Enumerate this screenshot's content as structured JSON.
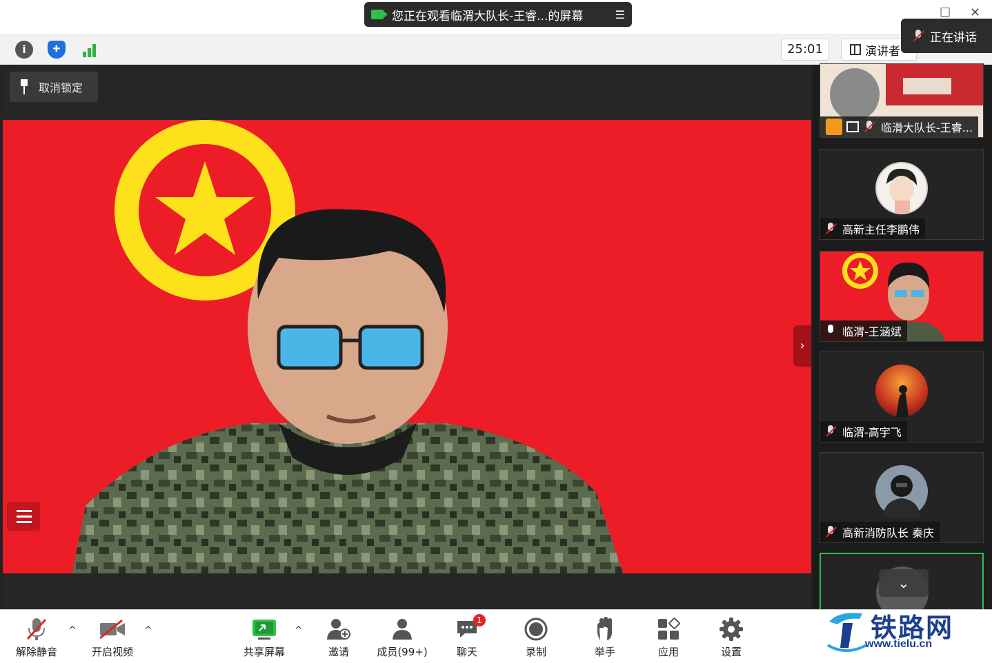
{
  "window": {
    "view_banner": "您正在观看临渭大队长-王睿...的屏幕",
    "view_menu_glyph": "☰"
  },
  "infobar": {
    "timer": "25:01",
    "view_mode_label": "演讲者",
    "speaking_label": "正在讲话"
  },
  "stage": {
    "unpin_label": "取消锁定",
    "side_toggle_glyph": "›"
  },
  "gallery": {
    "tiles": [
      {
        "name": "临滑大队长-王睿...",
        "mic": "off"
      },
      {
        "name": "高新主任李鹏伟",
        "mic": "off"
      },
      {
        "name": "临渭-王涵斌",
        "mic": "on"
      },
      {
        "name": "临渭-高宇飞",
        "mic": "off"
      },
      {
        "name": "高新消防队长 秦庆",
        "mic": "off"
      }
    ],
    "scroll_down_glyph": "⌄"
  },
  "toolbar": {
    "unmute": "解除静音",
    "start_video": "开启视频",
    "share_screen": "共享屏幕",
    "invite": "邀请",
    "members": "成员(99+)",
    "chat": "聊天",
    "chat_badge": "1",
    "record": "录制",
    "raise_hand": "举手",
    "apps": "应用",
    "settings": "设置"
  },
  "watermark": {
    "brand": "铁路网",
    "url": "www.tielu.cn"
  },
  "colors": {
    "flag_red": "#ec1d27",
    "emblem_yellow": "#fde11b",
    "accent_green": "#2fbf4a",
    "danger_red": "#e02424"
  }
}
